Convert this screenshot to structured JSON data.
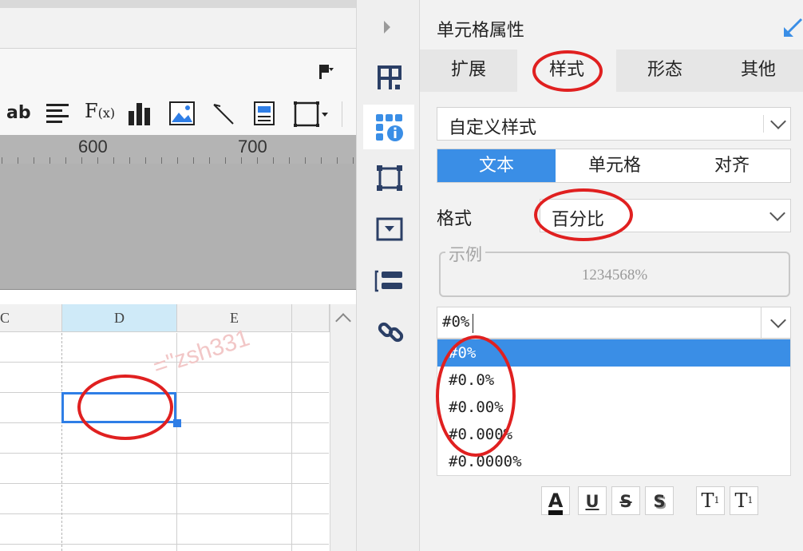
{
  "ruler": {
    "marks": [
      "600",
      "700"
    ]
  },
  "toolbar": {
    "text_tool_label": "ab"
  },
  "grid": {
    "columns": [
      {
        "name": "C",
        "selected": false
      },
      {
        "name": "D",
        "selected": true
      },
      {
        "name": "E",
        "selected": false
      }
    ],
    "watermark": "=\"zsh331"
  },
  "panel": {
    "title": "单元格属性",
    "tabs": [
      {
        "label": "扩展",
        "active": false
      },
      {
        "label": "样式",
        "active": true
      },
      {
        "label": "形态",
        "active": false
      },
      {
        "label": "其他",
        "active": false
      }
    ],
    "style_select": {
      "value": "自定义样式"
    },
    "segments": [
      {
        "label": "文本",
        "active": true
      },
      {
        "label": "单元格",
        "active": false
      },
      {
        "label": "对齐",
        "active": false
      }
    ],
    "format": {
      "label": "格式",
      "value": "百分比"
    },
    "example": {
      "legend": "示例",
      "value": "1234568%"
    },
    "pattern_input": {
      "value": "#0%"
    },
    "pattern_options": [
      {
        "label": "#0%",
        "highlighted": true
      },
      {
        "label": "#0.0%",
        "highlighted": false
      },
      {
        "label": "#0.00%",
        "highlighted": false
      },
      {
        "label": "#0.000%",
        "highlighted": false
      },
      {
        "label": "#0.0000%",
        "highlighted": false
      }
    ]
  },
  "colors": {
    "accent": "#3a8ee6",
    "annotation": "#e02020",
    "selection": "#2f7ee6"
  },
  "icons": [
    "flag-dropdown-icon",
    "text-tool-icon",
    "align-left-icon",
    "formula-icon",
    "bar-chart-icon",
    "image-icon",
    "slash-icon",
    "rich-text-icon",
    "border-dropdown-icon",
    "collapse-arrow-icon",
    "table-layout-icon",
    "cell-info-icon",
    "frame-icon",
    "widget-icon",
    "list-icon",
    "link-icon",
    "expand-arrow-icon",
    "chevron-down-icon",
    "font-color-icon",
    "underline-icon",
    "strikethrough-icon",
    "shadow-icon",
    "superscript-icon",
    "subscript-icon"
  ]
}
